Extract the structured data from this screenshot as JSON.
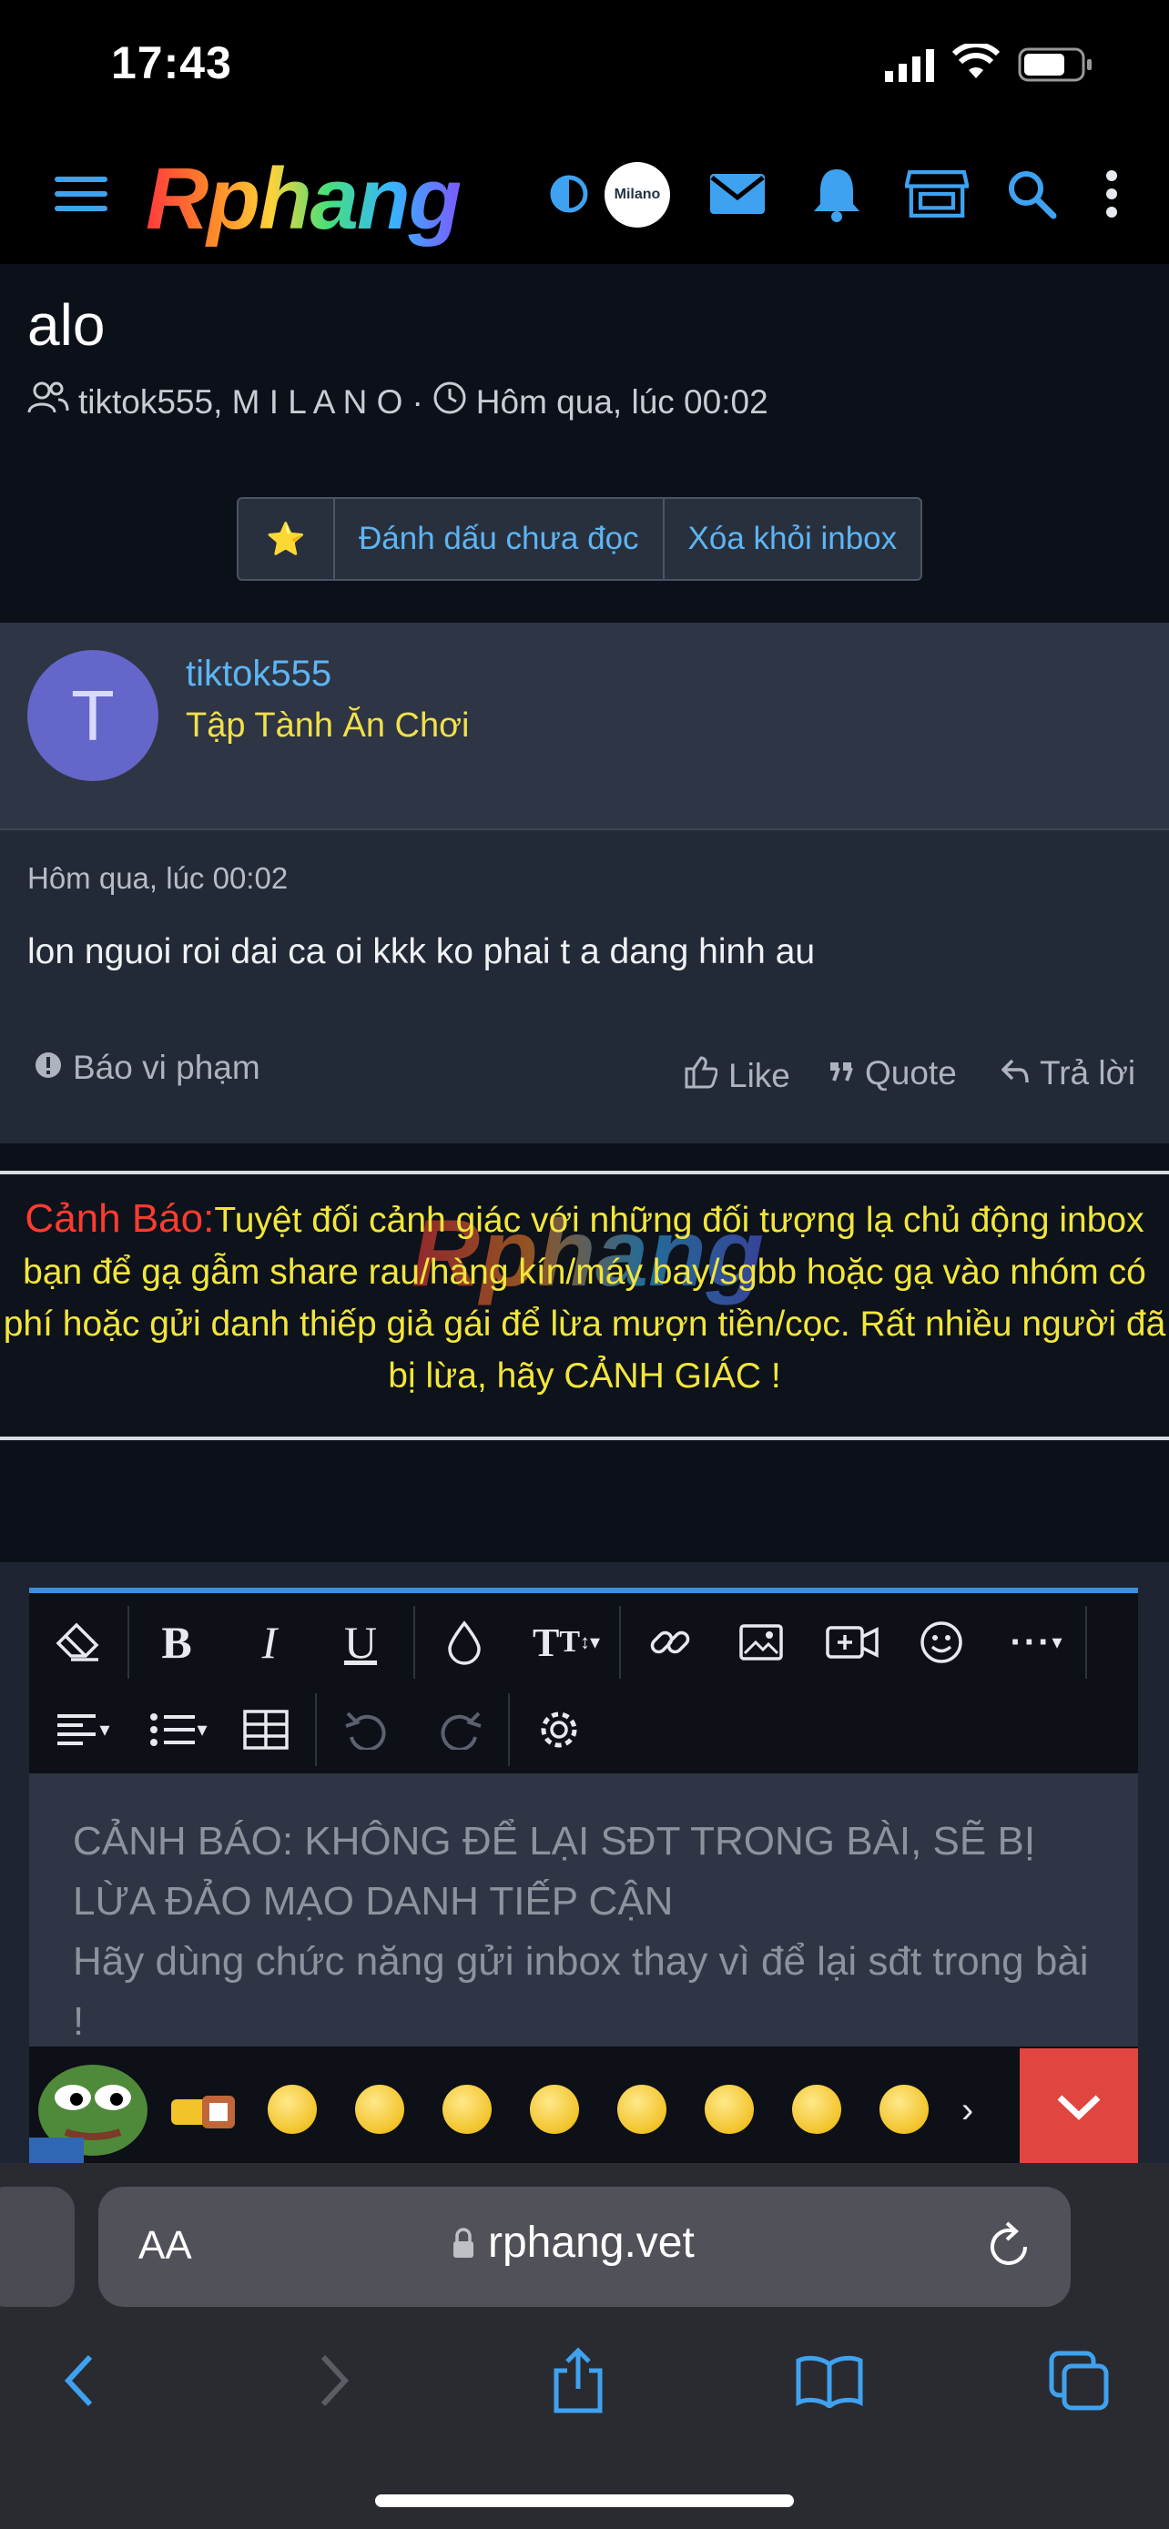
{
  "status_bar": {
    "time": "17:43"
  },
  "header": {
    "logo": "Rphang",
    "avatar_text": "Milano"
  },
  "conversation": {
    "title": "alo",
    "participants": "tiktok555, M I L A N O",
    "separator": "·",
    "date": "Hôm qua, lúc 00:02",
    "actions": {
      "star": "⭐",
      "mark_unread": "Đánh dấu chưa đọc",
      "remove_inbox": "Xóa khỏi inbox"
    }
  },
  "message": {
    "avatar_letter": "T",
    "username": "tiktok555",
    "user_title": "Tập Tành Ăn Chơi",
    "date": "Hôm qua, lúc 00:02",
    "text": "lon nguoi roi dai ca oi kkk ko phai t a dang hinh au",
    "report": "Báo vi phạm",
    "like": "Like",
    "quote": "Quote",
    "reply": "Trả lời"
  },
  "warning": {
    "label": "Cảnh Báo:",
    "text": "Tuyệt đối cảnh giác với những đối tượng lạ chủ động inbox bạn để gạ gẫm share rau/hàng kín/máy bay/sgbb hoặc gạ vào nhóm có phí hoặc gửi danh thiếp giả gái để lừa mượn tiền/cọc. Rất nhiều người đã bị lừa, hãy CẢNH GIÁC !",
    "watermark": "Rphang"
  },
  "editor": {
    "placeholder_line1": "CẢNH BÁO: KHÔNG ĐỂ LẠI SĐT TRONG BÀI, SẼ BỊ LỪA ĐẢO MẠO DANH TIẾP CẬN",
    "placeholder_line2": "Hãy dùng chức năng gửi inbox thay vì để lại sđt trong bài !",
    "toolbar_icons": [
      "eraser-icon",
      "bold-icon",
      "italic-icon",
      "underline-icon",
      "color-drop-icon",
      "text-size-icon",
      "link-icon",
      "image-icon",
      "video-icon",
      "smilie-icon",
      "more-icon",
      "align-icon",
      "list-icon",
      "table-icon",
      "undo-icon",
      "redo-icon",
      "settings-icon"
    ]
  },
  "browser": {
    "aa": "AA",
    "url": "rphang.vet"
  }
}
